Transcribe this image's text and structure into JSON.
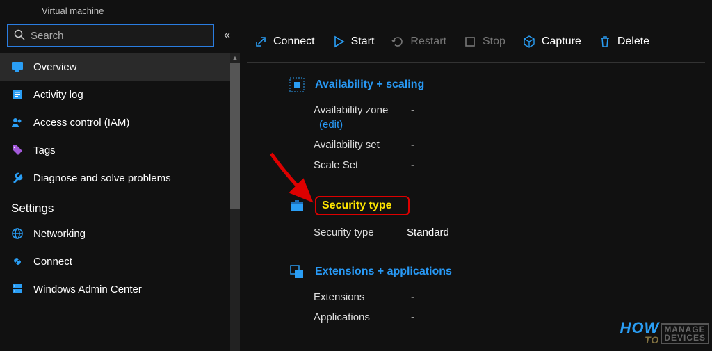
{
  "header": {
    "subtitle": "Virtual machine"
  },
  "search": {
    "placeholder": "Search"
  },
  "nav": {
    "items": [
      {
        "label": "Overview",
        "icon": "vm-icon",
        "selected": true
      },
      {
        "label": "Activity log",
        "icon": "log-icon"
      },
      {
        "label": "Access control (IAM)",
        "icon": "people-icon"
      },
      {
        "label": "Tags",
        "icon": "tag-icon"
      },
      {
        "label": "Diagnose and solve problems",
        "icon": "wrench-icon"
      }
    ],
    "section": "Settings",
    "settingsItems": [
      {
        "label": "Networking",
        "icon": "globe-icon"
      },
      {
        "label": "Connect",
        "icon": "connect-icon"
      },
      {
        "label": "Windows Admin Center",
        "icon": "server-icon"
      }
    ]
  },
  "toolbar": {
    "connect": "Connect",
    "start": "Start",
    "restart": "Restart",
    "stop": "Stop",
    "capture": "Capture",
    "delete": "Delete"
  },
  "sections": {
    "availability": {
      "title": "Availability + scaling",
      "zone_key": "Availability zone",
      "zone_val": "-",
      "edit": "(edit)",
      "set_key": "Availability set",
      "set_val": "-",
      "scale_key": "Scale Set",
      "scale_val": "-"
    },
    "security": {
      "title": "Security type",
      "type_key": "Security type",
      "type_val": "Standard"
    },
    "extensions": {
      "title": "Extensions + applications",
      "ext_key": "Extensions",
      "ext_val": "-",
      "app_key": "Applications",
      "app_val": "-"
    }
  },
  "watermark": {
    "how": "HOW",
    "to": "TO",
    "line1": "MANAGE",
    "line2": "DEVICES"
  }
}
